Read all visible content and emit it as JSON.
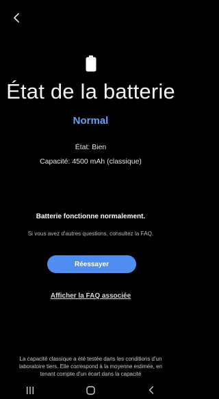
{
  "header": {
    "back_icon": "chevron-left-icon"
  },
  "hero": {
    "icon": "battery-full-icon",
    "title": "État de la batterie",
    "status": "Normal",
    "status_color": "#6f9cf2"
  },
  "details": {
    "state": "État: Bien",
    "capacity": "Capacité: 4500 mAh (classique)"
  },
  "message": {
    "headline": "Batterie fonctionne normalement.",
    "hint": "Si vous avez d'autres questions, consultez la FAQ."
  },
  "actions": {
    "retry_label": "Réessayer",
    "retry_color": "#4f8ef0",
    "faq_link_label": "Afficher la FAQ associée"
  },
  "footnote": {
    "text": "La capacité classique a été testée dans les conditions d'un laboratoire tiers. Elle correspond à la moyenne estimée, en tenant compte d'un écart dans la capacité"
  },
  "navigation": {
    "recents_icon": "recents-icon",
    "home_icon": "home-icon",
    "back_icon": "back-icon"
  }
}
